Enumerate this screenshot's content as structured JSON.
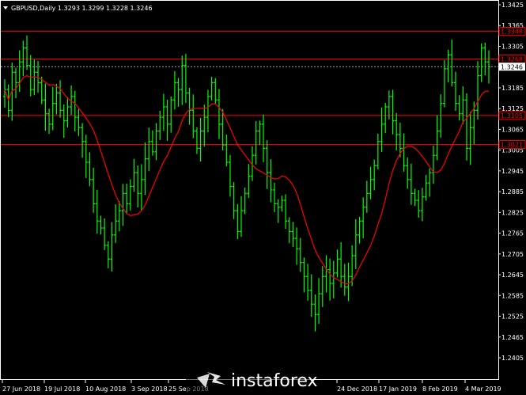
{
  "header": {
    "symbol_title": "GBPUSD,Daily  1.3293 1.3299 1.3228 1.3246"
  },
  "watermark": {
    "text": "instaforex"
  },
  "colors": {
    "background": "#000000",
    "candles": "#00ff00",
    "ma_line": "#ff0000",
    "levels": "#ff0000",
    "current_price_bg": "#ffffff",
    "current_price_text": "#000000",
    "axis_text": "#ffffff",
    "axis_line": "#ffffff"
  },
  "icons": {
    "title_marker": "triangle-down-icon",
    "watermark_logo": "instaforex-logo-icon"
  },
  "chart_data": {
    "type": "ohlc",
    "y_tick_labels": [
      "1.3425",
      "1.3365",
      "1.3305",
      "1.3245",
      "1.3185",
      "1.3125",
      "1.3065",
      "1.3005",
      "1.2945",
      "1.2885",
      "1.2825",
      "1.2765",
      "1.2705",
      "1.2645",
      "1.2585",
      "1.2525",
      "1.2465",
      "1.2405"
    ],
    "x_tick_labels": [
      "27 Jun 2018",
      "19 Jul 2018",
      "10 Aug 2018",
      "3 Sep 2018",
      "25 Sep 2018",
      "24 Dec 2018",
      "17 Jan 2019",
      "8 Feb 2019",
      "4 Mar 2019"
    ],
    "levels": [
      {
        "value": 1.3348,
        "label": "1.3348"
      },
      {
        "value": 1.3268,
        "label": "1.3268"
      },
      {
        "value": 1.3105,
        "label": "1.3105"
      },
      {
        "value": 1.3021,
        "label": "1.3021"
      }
    ],
    "current_price": {
      "value": 1.3246,
      "label": "1.3246"
    },
    "ylim": [
      1.2405,
      1.3425
    ],
    "candle_closes": [
      1.318,
      1.312,
      1.323,
      1.32,
      1.326,
      1.33,
      1.325,
      1.318,
      1.323,
      1.32,
      1.315,
      1.311,
      1.308,
      1.314,
      1.317,
      1.312,
      1.309,
      1.313,
      1.316,
      1.31,
      1.307,
      1.303,
      1.297,
      1.292,
      1.285,
      1.28,
      1.278,
      1.273,
      1.269,
      1.276,
      1.28,
      1.283,
      1.288,
      1.285,
      1.29,
      1.294,
      1.288,
      1.292,
      1.298,
      1.303,
      1.3,
      1.306,
      1.31,
      1.313,
      1.308,
      1.315,
      1.32,
      1.318,
      1.325,
      1.317,
      1.312,
      1.306,
      1.301,
      1.306,
      1.31,
      1.316,
      1.32,
      1.315,
      1.308,
      1.302,
      1.297,
      1.29,
      1.283,
      1.277,
      1.283,
      1.288,
      1.293,
      1.299,
      1.306,
      1.308,
      1.301,
      1.294,
      1.289,
      1.285,
      1.284,
      1.286,
      1.28,
      1.277,
      1.275,
      1.272,
      1.268,
      1.264,
      1.26,
      1.256,
      1.253,
      1.259,
      1.264,
      1.266,
      1.262,
      1.265,
      1.269,
      1.264,
      1.261,
      1.264,
      1.27,
      1.276,
      1.28,
      1.284,
      1.288,
      1.292,
      1.296,
      1.303,
      1.308,
      1.313,
      1.316,
      1.309,
      1.305,
      1.301,
      1.296,
      1.292,
      1.288,
      1.286,
      1.283,
      1.287,
      1.291,
      1.294,
      1.299,
      1.306,
      1.314,
      1.324,
      1.328,
      1.32,
      1.314,
      1.311,
      1.315,
      1.301,
      1.307,
      1.312,
      1.322,
      1.33,
      1.326,
      1.3246
    ]
  }
}
